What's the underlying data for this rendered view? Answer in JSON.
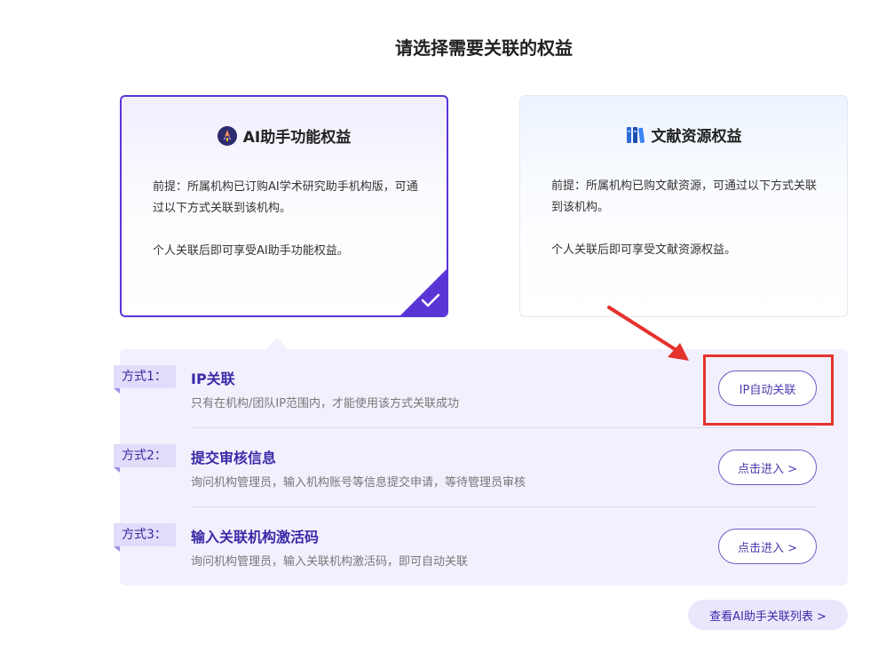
{
  "page": {
    "title": "请选择需要关联的权益"
  },
  "cards": [
    {
      "title": "AI助手功能权益",
      "icon": "ai-rocket-icon",
      "selected": true,
      "desc_line1": "前提：所属机构已订购AI学术研究助手机构版，可通过以下方式关联到该机构。",
      "desc_line2": "个人关联后即可享受AI助手功能权益。"
    },
    {
      "title": "文献资源权益",
      "icon": "books-icon",
      "selected": false,
      "desc_line1": "前提：所属机构已购文献资源，可通过以下方式关联到该机构。",
      "desc_line2": "个人关联后即可享受文献资源权益。"
    }
  ],
  "methods": [
    {
      "tag": "方式1：",
      "title": "IP关联",
      "desc": "只有在机构/团队IP范围内，才能使用该方式关联成功",
      "button": "IP自动关联"
    },
    {
      "tag": "方式2：",
      "title": "提交审核信息",
      "desc": "询问机构管理员，输入机构账号等信息提交申请，等待管理员审核",
      "button": "点击进入 >"
    },
    {
      "tag": "方式3：",
      "title": "输入关联机构激活码",
      "desc": "询问机构管理员，输入关联机构激活码，即可自动关联",
      "button": "点击进入 >"
    }
  ],
  "footer": {
    "view_list": "查看AI助手关联列表 >"
  },
  "colors": {
    "accent": "#5a35d6",
    "highlight": "#e5322d",
    "panel": "#f3f0fd"
  }
}
